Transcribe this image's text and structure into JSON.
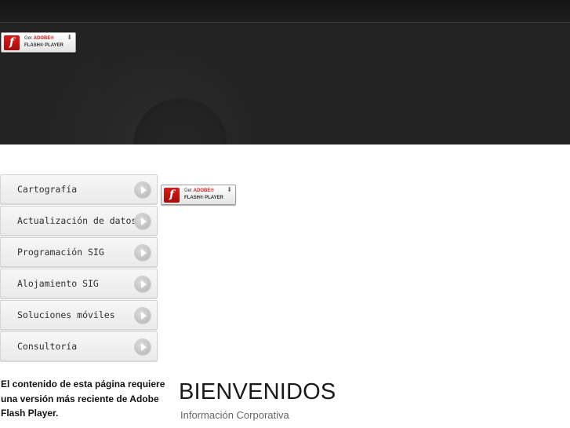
{
  "header": {
    "flash_badge": {
      "logo_glyph": "f",
      "line1_prefix": "Get",
      "line1_brand": "ADOBE®",
      "line2": "FLASH® PLAYER",
      "icon": "download-arrow-icon"
    }
  },
  "content_flash_badge": {
    "logo_glyph": "f",
    "line1_prefix": "Get",
    "line1_brand": "ADOBE®",
    "line2": "FLASH® PLAYER",
    "icon": "download-arrow-icon"
  },
  "menu": {
    "items": [
      {
        "label": "Cartografía",
        "icon": "play-arrow-icon"
      },
      {
        "label": "Actualización de datos",
        "icon": "play-arrow-icon"
      },
      {
        "label": "Programación SIG",
        "icon": "play-arrow-icon"
      },
      {
        "label": "Alojamiento SIG",
        "icon": "play-arrow-icon"
      },
      {
        "label": "Soluciones móviles",
        "icon": "play-arrow-icon"
      },
      {
        "label": "Consultoría",
        "icon": "play-arrow-icon"
      }
    ]
  },
  "notice": {
    "text": "El contenido de esta página requiere una versión más reciente de Adobe Flash Player."
  },
  "welcome": {
    "title": "BIENVENIDOS",
    "subtitle": "Información Corporativa"
  },
  "colors": {
    "header_bg": "#232323",
    "flash_red": "#c41a1a",
    "menu_text": "#2f2f2f",
    "title_text": "#1a1a1a",
    "subtitle_text": "#666666"
  }
}
